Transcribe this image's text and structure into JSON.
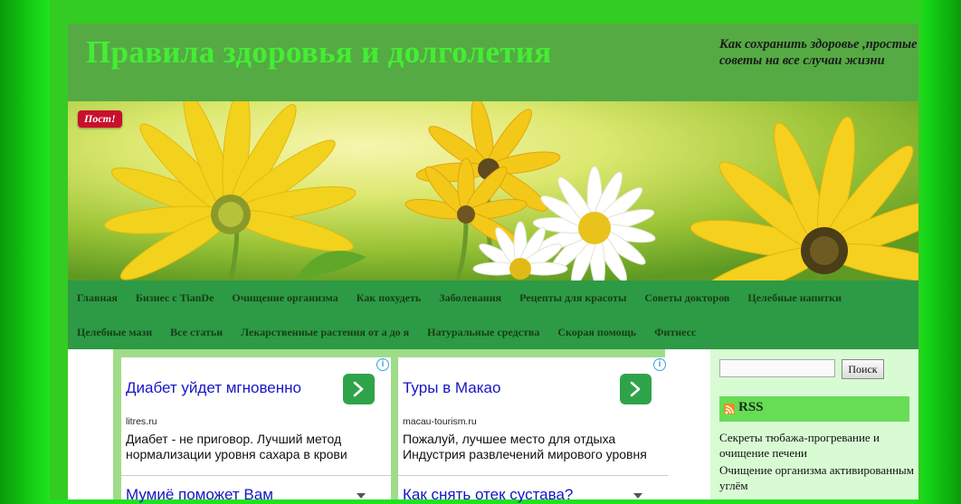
{
  "site": {
    "title": "Правила здоровья и долголетия",
    "tagline": "Как сохранить здоровье ,простые советы на все случаи жизни"
  },
  "banner": {
    "badge": "Пост!"
  },
  "nav": {
    "row1": [
      "Главная",
      "Бизнес с TianDe",
      "Очищение организма",
      "Как похудеть",
      "Заболевания",
      "Рецепты для красоты",
      "Советы докторов",
      "Целебные напитки"
    ],
    "row2": [
      "Целебные мази",
      "Все статьи",
      "Лекарственные растения от а до я",
      "Натуральные средства",
      "Скорая помощь",
      "Фитнесс"
    ]
  },
  "ads": [
    {
      "title": "Диабет уйдет мгновенно",
      "url": "litres.ru",
      "description": "Диабет - не приговор. Лучший метод нормализации уровня сахара в крови",
      "next_title": "Мумиё поможет Вам"
    },
    {
      "title": "Туры в Макао",
      "url": "macau-tourism.ru",
      "description": "Пожалуй, лучшее место для отдыха Индустрия развлечений мирового уровня",
      "next_title": "Как снять отек сустава?"
    }
  ],
  "sidebar": {
    "search_button": "Поиск",
    "rss_title": "RSS",
    "links": [
      "Секреты тюбажа-прогревание и очищение печени",
      "Очищение организма активированным углём"
    ]
  },
  "colors": {
    "page_green": "#1fe31f",
    "header_green": "#55aa44",
    "title_green": "#44ee33",
    "nav_green": "#2d9a45",
    "badge_red": "#c8102e",
    "ad_link_blue": "#1515c8",
    "sidebar_bg": "#d8fbd4"
  }
}
